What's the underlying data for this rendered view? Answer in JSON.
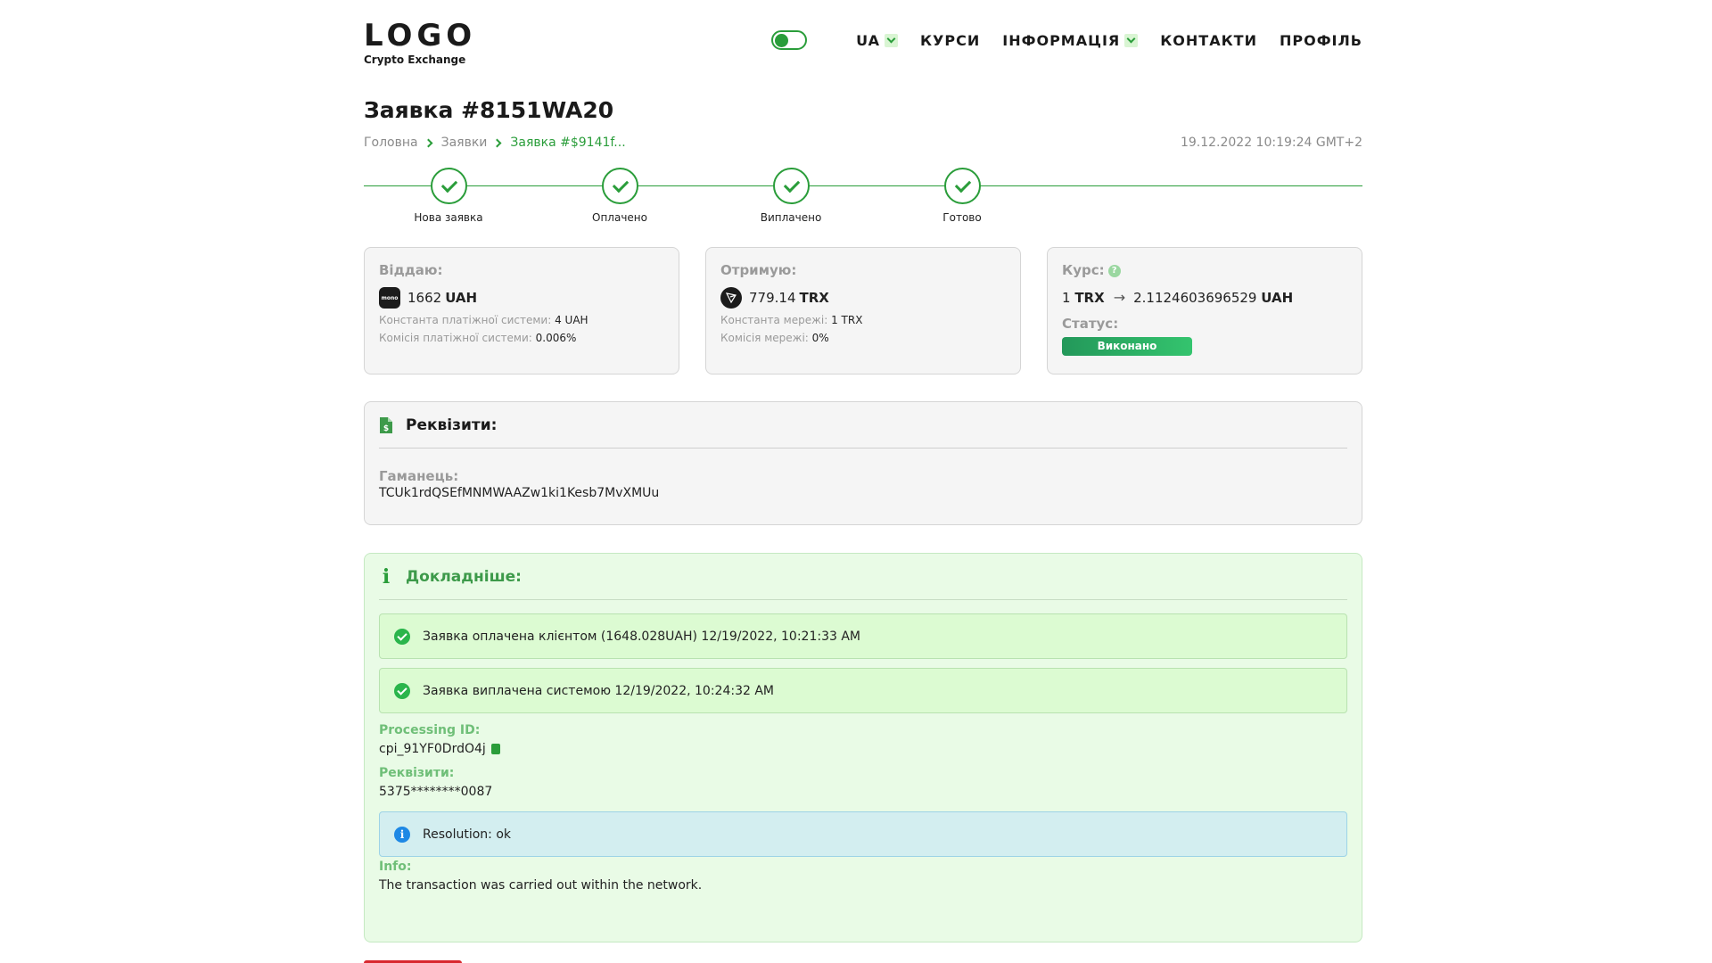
{
  "header": {
    "logo_main": "LOGO",
    "logo_sub": "Crypto Exchange",
    "lang": "UA",
    "nav": {
      "rates": "КУРСИ",
      "info": "ІНФОРМАЦІЯ",
      "contacts": "КОНТАКТИ",
      "profile": "ПРОФІЛЬ"
    }
  },
  "order": {
    "title": "Заявка #8151WA20",
    "timestamp": "19.12.2022 10:19:24 GMT+2"
  },
  "breadcrumb": {
    "home": "Головна",
    "orders": "Заявки",
    "current": "Заявка #$9141f..."
  },
  "steps": [
    {
      "label": "Нова заявка"
    },
    {
      "label": "Оплачено"
    },
    {
      "label": "Виплачено"
    },
    {
      "label": "Готово"
    }
  ],
  "give": {
    "label": "Віддаю:",
    "icon": "mono-bank-icon",
    "icon_text": "mono",
    "amount": "1662",
    "currency": "UAH",
    "const_label": "Константа платіжної системи:",
    "const_value": "4 UAH",
    "fee_label": "Комісія платіжної системи:",
    "fee_value": "0.006%"
  },
  "receive": {
    "label": "Отримую:",
    "icon": "tron-icon",
    "amount": "779.14",
    "currency": "TRX",
    "const_label": "Константа мережі:",
    "const_value": "1 TRX",
    "fee_label": "Комісія мережі:",
    "fee_value": "0%"
  },
  "rate": {
    "label": "Курс:",
    "from_amount": "1",
    "from_currency": "TRX",
    "to_amount": "2.1124603696529",
    "to_currency": "UAH",
    "status_label": "Статус:",
    "status_value": "Виконано",
    "status_color": "#2aa860"
  },
  "requisites": {
    "title": "Реквізити:",
    "wallet_label": "Гаманець:",
    "wallet_value": "TCUk1rdQSEfMNMWAAZw1ki1Kesb7MvXMUu"
  },
  "details": {
    "title": "Докладніше:",
    "alerts": [
      {
        "text": "Заявка оплачена клієнтом (1648.028UAH) 12/19/2022, 10:21:33 AM"
      },
      {
        "text": "Заявка виплачена системою 12/19/2022, 10:24:32 AM"
      }
    ],
    "processing_label": "Processing ID:",
    "processing_value": "cpi_91YF0DrdO4j",
    "req_label": "Реквізити:",
    "req_value": "5375********0087",
    "resolution": "Resolution: ok",
    "info_label": "Info:",
    "info_value": "The transaction was carried out within the network."
  },
  "colors": {
    "accent": "#2a9d3a",
    "details_bg": "#e9fbe6",
    "danger": "#d9282f"
  }
}
